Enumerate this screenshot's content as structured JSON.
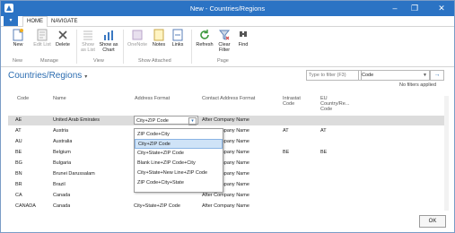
{
  "window": {
    "title": "New - Countries/Regions",
    "minimize": "–",
    "restore": "❐",
    "close": "✕"
  },
  "ribbon_tabs": [
    "HOME",
    "NAVIGATE"
  ],
  "ribbon": {
    "buttons": [
      "New",
      "Edit List",
      "Delete",
      "Show as List",
      "Show as Chart",
      "OneNote",
      "Notes",
      "Links",
      "Refresh",
      "Clear Filter",
      "Find"
    ],
    "groups": [
      "New",
      "Manage",
      "View",
      "Show Attached",
      "Page"
    ]
  },
  "page": {
    "title": "Countries/Regions",
    "filter_placeholder": "Type to filter (F3)",
    "filter_field": "Code",
    "no_filters": "No filters applied"
  },
  "columns": [
    "Code",
    "Name",
    "Address Format",
    "Contact Address Format",
    "Intrastat Code",
    "EU Country/Re... Code"
  ],
  "rows": [
    {
      "code": "AE",
      "name": "United Arab Emirates",
      "addr": "City+ZIP Code",
      "contact": "After Company Name",
      "intrastat": "",
      "eu": ""
    },
    {
      "code": "AT",
      "name": "Austria",
      "addr": "",
      "contact": "After Company Name",
      "intrastat": "AT",
      "eu": "AT"
    },
    {
      "code": "AU",
      "name": "Australia",
      "addr": "",
      "contact": "After Company Name",
      "intrastat": "",
      "eu": ""
    },
    {
      "code": "BE",
      "name": "Belgium",
      "addr": "",
      "contact": "After Company Name",
      "intrastat": "BE",
      "eu": "BE"
    },
    {
      "code": "BG",
      "name": "Bulgaria",
      "addr": "",
      "contact": "After Company Name",
      "intrastat": "",
      "eu": ""
    },
    {
      "code": "BN",
      "name": "Brunei Darussalam",
      "addr": "",
      "contact": "After Company Name",
      "intrastat": "",
      "eu": ""
    },
    {
      "code": "BR",
      "name": "Brazil",
      "addr": "",
      "contact": "After Company Name",
      "intrastat": "",
      "eu": ""
    },
    {
      "code": "CA",
      "name": "Canada",
      "addr": "",
      "contact": "After Company Name",
      "intrastat": "",
      "eu": ""
    },
    {
      "code": "CANADA",
      "name": "Canada",
      "addr": "City+State+ZIP Code",
      "contact": "After Company Name",
      "intrastat": "",
      "eu": ""
    }
  ],
  "dropdown_options": [
    "ZIP Code+City",
    "City+ZIP Code",
    "City+State+ZIP Code",
    "Blank Line+ZIP Code+City",
    "City+State+New Line+ZIP Code",
    "ZIP Code+City+State"
  ],
  "ok_label": "OK"
}
